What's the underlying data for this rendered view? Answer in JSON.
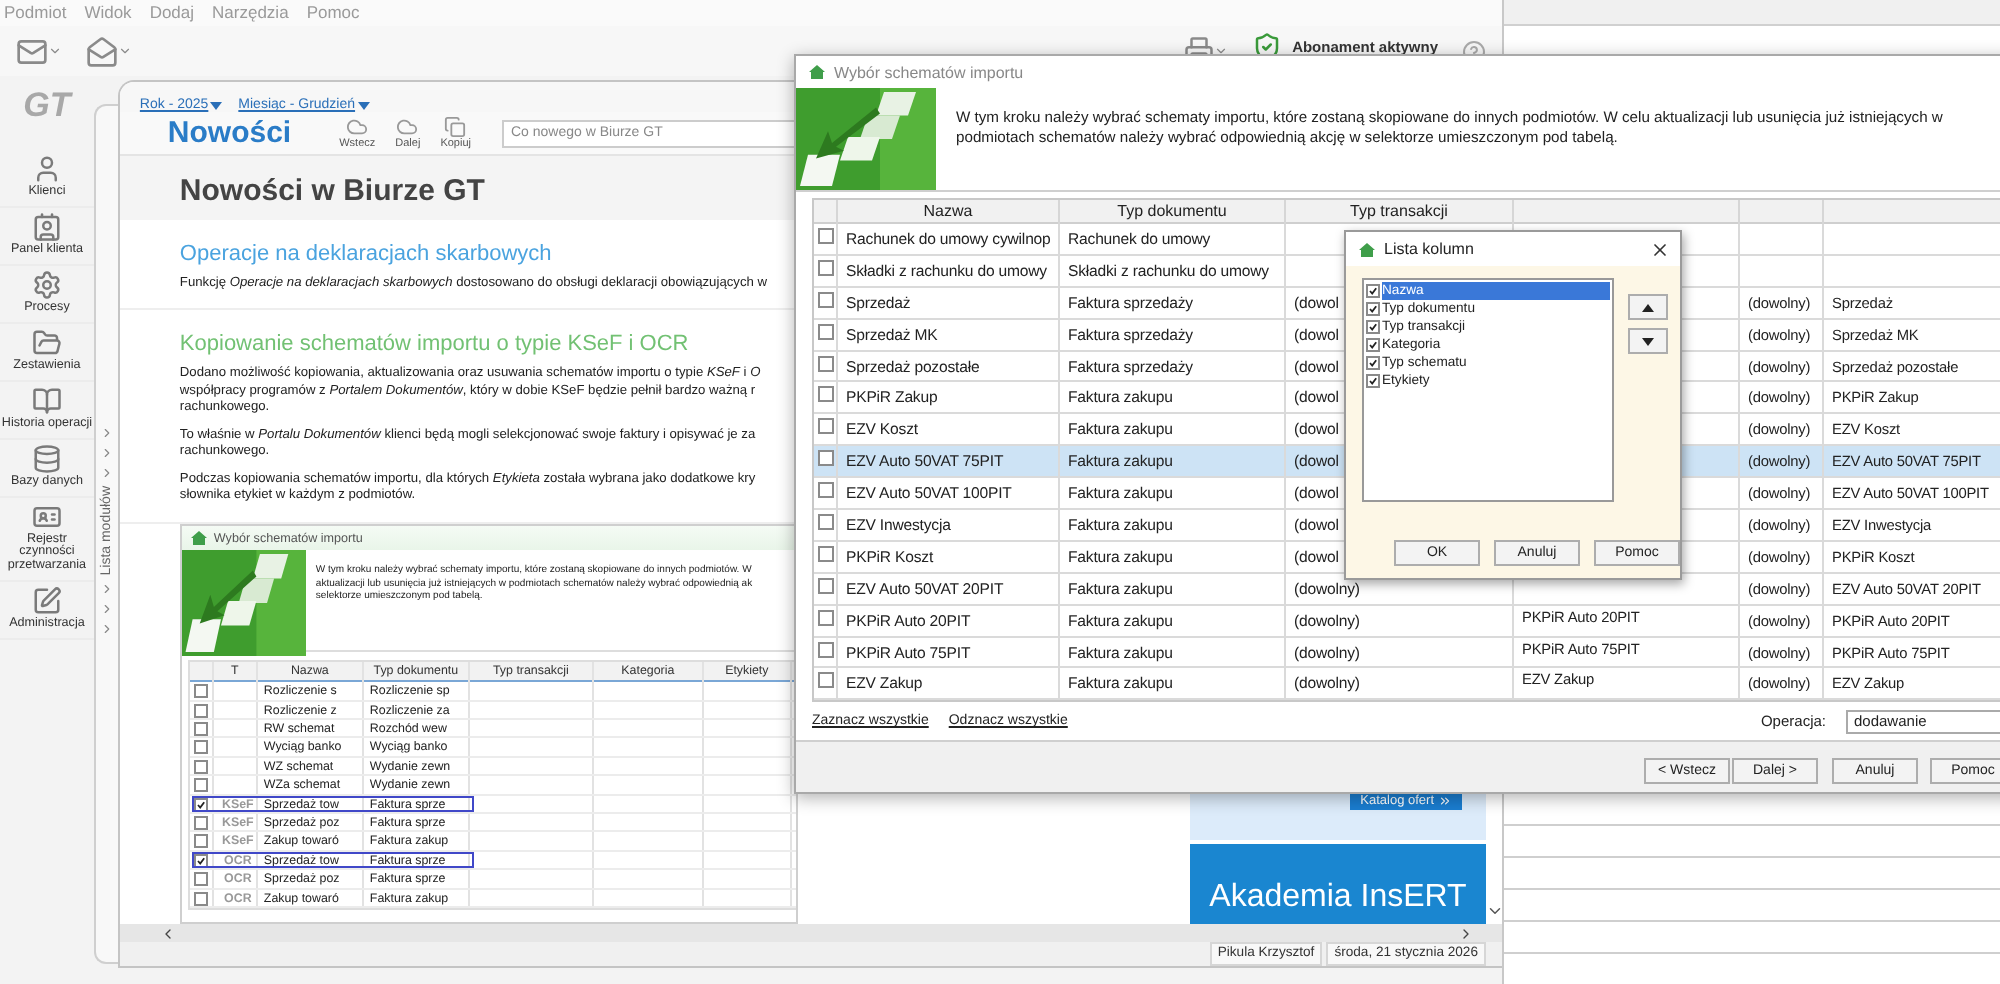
{
  "menu": [
    "Podmiot",
    "Widok",
    "Dodaj",
    "Narzędzia",
    "Pomoc"
  ],
  "toolbar": {
    "subscription": "Abonament aktywny"
  },
  "sidebar": {
    "logo": "GT",
    "items": [
      "Klienci",
      "Panel klienta",
      "Procesy",
      "Zestawienia",
      "Historia operacji",
      "Bazy danych",
      "Rejestr czynności przetwarzania",
      "Administracja"
    ]
  },
  "module_strip": {
    "label": "Lista modułów"
  },
  "main": {
    "filters": [
      "Rok - 2025",
      "Miesiąc - Grudzień"
    ],
    "title": "Nowości",
    "nav": [
      "Wstecz",
      "Dalej",
      "Kopiuj"
    ],
    "search": {
      "placeholder": "Co nowego w Biurze GT"
    },
    "page_title": "Nowości w Biurze GT",
    "sections": [
      {
        "heading": "Operacje na deklaracjach skarbowych",
        "color": "#4aa3df",
        "paragraphs": [
          [
            "Funkcję *Operacje na deklaracjach skarbowych* dostosowano do obsługi deklaracji obowiązujących w"
          ]
        ]
      },
      {
        "heading": "Kopiowanie schematów importu o typie KSeF i OCR",
        "color": "#72c173",
        "paragraphs": [
          [
            "Dodano możliwość kopiowania, aktualizowania oraz usuwania schematów importu o typie *KSeF* i *O*",
            "współpracy programów z *Portalem Dokumentów*, który w dobie KSeF będzie pełnił bardzo ważną r",
            "rachunkowego."
          ],
          [
            "To właśnie w *Portalu Dokumentów* klienci będą mogli selekcjonować swoje faktury i opisywać je za",
            "rachunkowego."
          ],
          [
            "Podczas kopiowania schematów importu, dla których *Etykieta* została wybrana jako dodatkowe kry",
            "słownika etykiet w każdym z podmiotów."
          ]
        ]
      }
    ],
    "screenshot": {
      "title": "Wybór schematów importu",
      "description": [
        "W tym kroku należy wybrać schematy importu, które zostaną skopiowane do innych podmiotów. W",
        "aktualizacji lub usunięcia już istniejących w podmiotach schematów należy wybrać odpowiednią ak",
        "selektorze umieszczonym pod tabelą."
      ],
      "columns": [
        "T",
        "Nazwa",
        "Typ dokumentu",
        "Typ transakcji",
        "Kategoria",
        "Etykiety"
      ],
      "rows": [
        {
          "checked": false,
          "highlighted": false,
          "name": "Rozliczenie s",
          "doc_type": "Rozliczenie sp"
        },
        {
          "checked": false,
          "highlighted": false,
          "name": "Rozliczenie z",
          "doc_type": "Rozliczenie za"
        },
        {
          "checked": false,
          "highlighted": false,
          "name": "RW schemat",
          "doc_type": "Rozchód wew"
        },
        {
          "checked": false,
          "highlighted": false,
          "name": "Wyciąg banko",
          "doc_type": "Wyciąg banko"
        },
        {
          "checked": false,
          "highlighted": false,
          "name": "WZ schemat",
          "doc_type": "Wydanie zewn"
        },
        {
          "checked": false,
          "highlighted": false,
          "name": "WZa schemat",
          "doc_type": "Wydanie zewn"
        },
        {
          "checked": true,
          "highlighted": true,
          "type": "KSeF",
          "name": "Sprzedaż tow",
          "doc_type": "Faktura sprze"
        },
        {
          "checked": false,
          "highlighted": false,
          "type": "KSeF",
          "name": "Sprzedaż poz",
          "doc_type": "Faktura sprze"
        },
        {
          "checked": false,
          "highlighted": false,
          "type": "KSeF",
          "name": "Zakup towaró",
          "doc_type": "Faktura zakup"
        },
        {
          "checked": true,
          "highlighted": true,
          "type": "OCR",
          "name": "Sprzedaż tow",
          "doc_type": "Faktura sprze"
        },
        {
          "checked": false,
          "highlighted": false,
          "type": "OCR",
          "name": "Sprzedaż poz",
          "doc_type": "Faktura sprze"
        },
        {
          "checked": false,
          "highlighted": false,
          "type": "OCR",
          "name": "Zakup towaró",
          "doc_type": "Faktura zakup"
        }
      ]
    },
    "ads": {
      "button": "Katalog ofert",
      "banner": "Akademia InsERT"
    },
    "status_bar": [
      "Pikula Krzysztof",
      "środa, 21 stycznia 2026"
    ]
  },
  "dialog": {
    "title": "Wybór schematów importu",
    "description": "W tym kroku należy wybrać schematy importu, które zostaną skopiowane do innych podmiotów. W celu aktualizacji lub usunięcia już istniejących w podmiotach schematów należy wybrać odpowiednią akcję w selektorze umieszczonym pod tabelą.",
    "columns": [
      "Nazwa",
      "Typ dokumentu",
      "Typ transakcji"
    ],
    "rows": [
      {
        "checked": false,
        "selected": false,
        "name": "Rachunek do umowy cywilnop",
        "doc_type": "Rachunek do umowy"
      },
      {
        "checked": false,
        "selected": false,
        "name": "Składki z rachunku do umowy",
        "doc_type": "Składki z rachunku do umowy"
      },
      {
        "checked": false,
        "selected": false,
        "name": "Sprzedaż",
        "doc_type": "Faktura sprzedaży",
        "transaction": "(dowol",
        "column_5": "(dowolny)",
        "column_6": "Sprzedaż"
      },
      {
        "checked": false,
        "selected": false,
        "name": "Sprzedaż MK",
        "doc_type": "Faktura sprzedaży",
        "transaction": "(dowol",
        "column_5": "(dowolny)",
        "column_6": "Sprzedaż MK"
      },
      {
        "checked": false,
        "selected": false,
        "name": "Sprzedaż pozostałe",
        "doc_type": "Faktura sprzedaży",
        "transaction": "(dowol",
        "column_5": "(dowolny)",
        "column_6": "Sprzedaż pozostałe"
      },
      {
        "checked": false,
        "selected": false,
        "name": "PKPiR Zakup",
        "doc_type": "Faktura zakupu",
        "transaction": "(dowol",
        "column_5": "(dowolny)",
        "column_6": "PKPiR Zakup"
      },
      {
        "checked": false,
        "selected": false,
        "name": "EZV Koszt",
        "doc_type": "Faktura zakupu",
        "transaction": "(dowol",
        "column_5": "(dowolny)",
        "column_6": "EZV Koszt"
      },
      {
        "checked": false,
        "selected": true,
        "name": "EZV Auto 50VAT 75PIT",
        "doc_type": "Faktura zakupu",
        "transaction": "(dowol",
        "column_5": "(dowolny)",
        "column_6": "EZV Auto 50VAT 75PIT"
      },
      {
        "checked": false,
        "selected": false,
        "name": "EZV Auto 50VAT 100PIT",
        "doc_type": "Faktura zakupu",
        "transaction": "(dowol",
        "column_5": "(dowolny)",
        "column_6": "EZV Auto 50VAT 100PIT"
      },
      {
        "checked": false,
        "selected": false,
        "name": "EZV Inwestycja",
        "doc_type": "Faktura zakupu",
        "transaction": "(dowol",
        "column_5": "(dowolny)",
        "column_6": "EZV Inwestycja"
      },
      {
        "checked": false,
        "selected": false,
        "name": "PKPiR Koszt",
        "doc_type": "Faktura zakupu",
        "transaction": "(dowol",
        "column_5": "(dowolny)",
        "column_6": "PKPiR Koszt"
      },
      {
        "checked": false,
        "selected": false,
        "name": "EZV Auto 50VAT 20PIT",
        "doc_type": "Faktura zakupu",
        "transaction": "(dowolny)",
        "column_5": "(dowolny)",
        "column_6": "EZV Auto 50VAT 20PIT"
      },
      {
        "checked": false,
        "selected": false,
        "name": "PKPiR Auto 20PIT",
        "doc_type": "Faktura zakupu",
        "transaction": "(dowolny)",
        "column_4": "PKPiR Auto 20PIT",
        "column_5": "(dowolny)",
        "column_6": "PKPiR Auto 20PIT"
      },
      {
        "checked": false,
        "selected": false,
        "name": "PKPiR Auto 75PIT",
        "doc_type": "Faktura zakupu",
        "transaction": "(dowolny)",
        "column_4": "PKPiR Auto 75PIT",
        "column_5": "(dowolny)",
        "column_6": "PKPiR Auto 75PIT"
      },
      {
        "checked": false,
        "selected": false,
        "name": "EZV Zakup",
        "doc_type": "Faktura zakupu",
        "transaction": "(dowolny)",
        "column_4": "EZV Zakup",
        "column_5": "(dowolny)",
        "column_6": "EZV Zakup"
      }
    ],
    "links": [
      "Zaznacz wszystkie",
      "Odznacz wszystkie"
    ],
    "operation": {
      "label": "Operacja:",
      "value": "dodawanie"
    },
    "buttons": [
      "< Wstecz",
      "Dalej >",
      "Anuluj",
      "Pomoc"
    ]
  },
  "column_list": {
    "title": "Lista kolumn",
    "items": [
      {
        "label": "Nazwa",
        "checked": true,
        "selected": true
      },
      {
        "label": "Typ dokumentu",
        "checked": true,
        "selected": false
      },
      {
        "label": "Typ transakcji",
        "checked": true,
        "selected": false
      },
      {
        "label": "Kategoria",
        "checked": true,
        "selected": false
      },
      {
        "label": "Typ schematu",
        "checked": true,
        "selected": false
      },
      {
        "label": "Etykiety",
        "checked": true,
        "selected": false
      }
    ],
    "buttons": [
      "OK",
      "Anuluj",
      "Pomoc"
    ]
  }
}
